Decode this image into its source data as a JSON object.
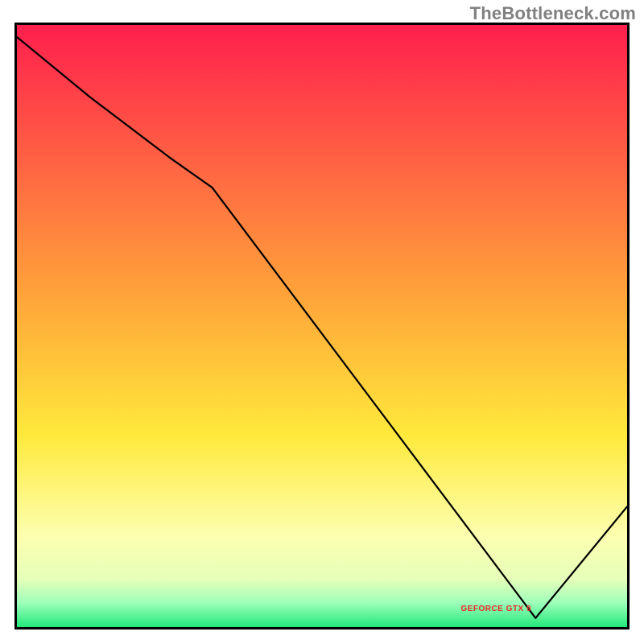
{
  "watermark": "TheBottleneck.com",
  "annotation": {
    "text": "GEFORCE GTX 9"
  },
  "chart_data": {
    "type": "line",
    "title": "",
    "xlabel": "",
    "ylabel": "",
    "xlim": [
      0,
      100
    ],
    "ylim": [
      0,
      100
    ],
    "grid": false,
    "legend": false,
    "background_gradient": {
      "stops": [
        {
          "pos": 0,
          "color": "#ff1f4d"
        },
        {
          "pos": 45,
          "color": "#ffa43a"
        },
        {
          "pos": 68,
          "color": "#ffe93b"
        },
        {
          "pos": 85,
          "color": "#fcffb0"
        },
        {
          "pos": 92,
          "color": "#e6ffb9"
        },
        {
          "pos": 96,
          "color": "#9dffba"
        },
        {
          "pos": 100,
          "color": "#22e87a"
        }
      ]
    },
    "series": [
      {
        "name": "bottleneck-curve",
        "x": [
          0,
          12,
          25,
          32,
          85,
          100
        ],
        "y": [
          98,
          88,
          78,
          73,
          1.5,
          20
        ],
        "note": "y is percent height from bottom; the curve descends, reaches a minimum near x≈85 (the green band), then rises again toward the right edge."
      }
    ],
    "annotations": [
      {
        "text": "GEFORCE GTX 9",
        "x": 80,
        "y": 3
      }
    ]
  }
}
